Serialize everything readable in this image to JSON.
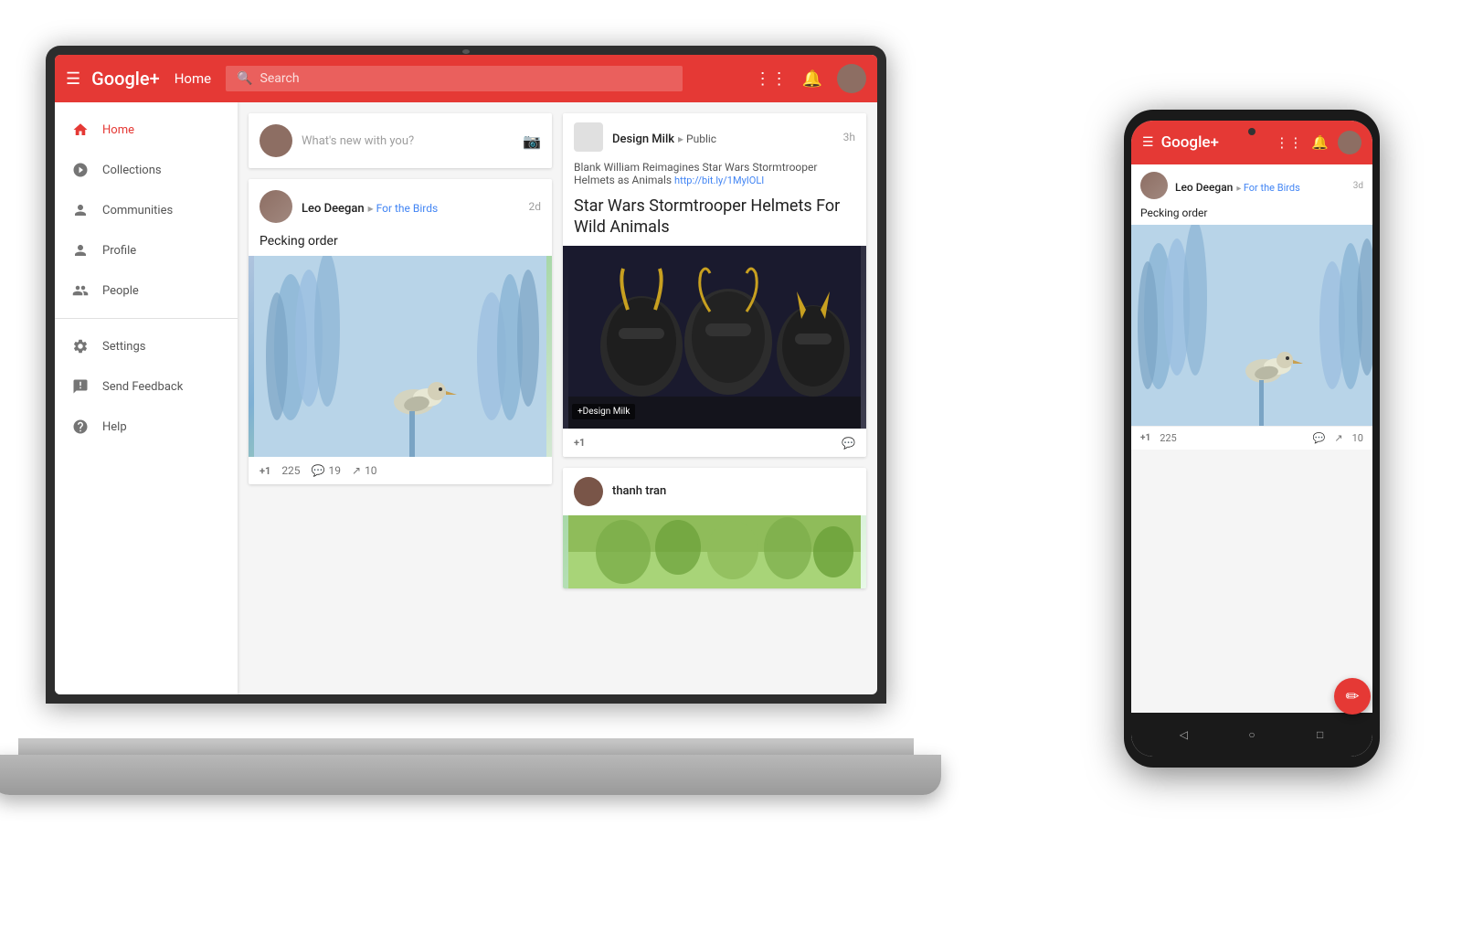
{
  "app": {
    "name": "Google+",
    "topbar": {
      "home_label": "Home",
      "search_placeholder": "Search"
    },
    "sidebar": {
      "items": [
        {
          "id": "home",
          "label": "Home",
          "icon": "home",
          "active": true
        },
        {
          "id": "collections",
          "label": "Collections",
          "icon": "collections"
        },
        {
          "id": "communities",
          "label": "Communities",
          "icon": "communities"
        },
        {
          "id": "profile",
          "label": "Profile",
          "icon": "profile"
        },
        {
          "id": "people",
          "label": "People",
          "icon": "people"
        },
        {
          "id": "settings",
          "label": "Settings",
          "icon": "settings"
        },
        {
          "id": "send-feedback",
          "label": "Send Feedback",
          "icon": "feedback"
        },
        {
          "id": "help",
          "label": "Help",
          "icon": "help"
        }
      ]
    },
    "feed": {
      "whats_new": "What's new with you?",
      "post1": {
        "author": "Leo Deegan",
        "circle": "For the Birds",
        "time": "2d",
        "title": "Pecking order",
        "plus_count": "225",
        "comment_count": "19",
        "share_count": "10"
      },
      "post2": {
        "author": "Design Milk",
        "circle": "Public",
        "time": "3h",
        "subtitle": "Blank William Reimagines Star Wars Stormtrooper Helmets as Animals",
        "link": "http://bit.ly/1MyIOLI",
        "headline": "Star Wars Stormtrooper Helmets For Wild Animals",
        "label": "+Design Milk"
      },
      "post3": {
        "author": "thanh tran"
      }
    }
  },
  "phone": {
    "post": {
      "author": "Leo Deegan",
      "circle": "For the Birds",
      "time": "3d",
      "title": "Pecking order",
      "plus_count": "225",
      "comment_count": "",
      "share_count": "10"
    }
  },
  "icons": {
    "hamburger": "☰",
    "search": "🔍",
    "grid": "⋮⋮⋮",
    "bell": "🔔",
    "camera": "📷",
    "plus_one": "+1",
    "comment": "💬",
    "share": "↗",
    "back": "◁",
    "home_circle": "○",
    "square": "□",
    "pencil": "✏"
  }
}
